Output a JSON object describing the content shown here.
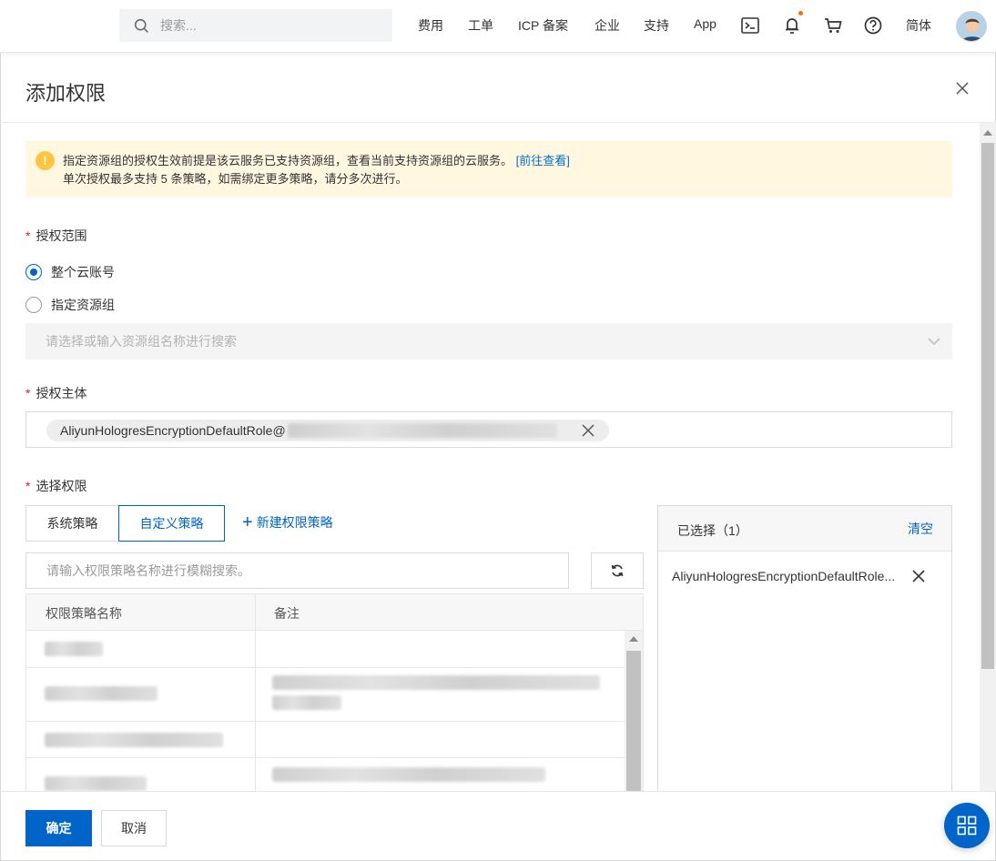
{
  "nav": {
    "search_placeholder": "搜索...",
    "items": [
      "费用",
      "工单",
      "ICP 备案",
      "企业",
      "支持",
      "App"
    ],
    "lang": "简体",
    "icons": [
      "terminal-icon",
      "bell-icon",
      "cart-icon",
      "help-icon"
    ],
    "notification_dot_color": "#ff6a00"
  },
  "dialog": {
    "title": "添加权限",
    "alert": {
      "line1": "指定资源组的授权生效前提是该云服务已支持资源组，查看当前支持资源组的云服务。",
      "link": "[前往查看]",
      "line2": "单次授权最多支持 5 条策略，如需绑定更多策略，请分多次进行。"
    },
    "scope": {
      "label": "授权范围",
      "options": [
        "整个云账号",
        "指定资源组"
      ],
      "selected": "整个云账号",
      "resource_group_placeholder": "请选择或输入资源组名称进行搜索"
    },
    "principal": {
      "label": "授权主体",
      "tag_text": "AliyunHologresEncryptionDefaultRole@"
    },
    "permissions": {
      "label": "选择权限",
      "tabs": [
        "系统策略",
        "自定义策略"
      ],
      "active_tab": "自定义策略",
      "new_policy": "新建权限策略",
      "search_placeholder": "请输入权限策略名称进行模糊搜索。",
      "columns": [
        "权限策略名称",
        "备注"
      ]
    },
    "selected": {
      "title": "已选择（1）",
      "clear": "清空",
      "items": [
        "AliyunHologresEncryptionDefaultRole..."
      ]
    },
    "footer": {
      "ok": "确定",
      "cancel": "取消"
    }
  },
  "colors": {
    "primary": "#0064c8",
    "warning_bg": "#fff7e0",
    "warning_icon": "#ffc440",
    "required": "#e02020"
  }
}
